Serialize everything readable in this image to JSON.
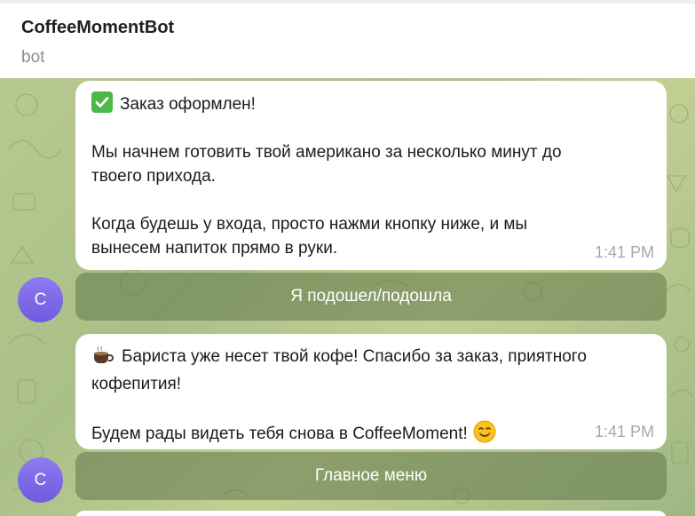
{
  "header": {
    "title": "CoffeeMomentBot",
    "subtitle": "bot"
  },
  "messages": [
    {
      "lines": [
        {
          "text": "Заказ оформлен!",
          "icon": "check-mark-emoji"
        },
        {
          "text": ""
        },
        {
          "text": "Мы начнем готовить твой американо за несколько минут до"
        },
        {
          "text": "твоего прихода."
        },
        {
          "text": ""
        },
        {
          "text": "Когда будешь у входа, просто нажми кнопку ниже, и мы"
        },
        {
          "text": "вынесем напиток прямо в руки."
        }
      ],
      "time": "1:41 PM",
      "button": "Я подошел/подошла"
    },
    {
      "lines": [
        {
          "text": "Бариста уже несет твой кофе! Спасибо за заказ, приятного",
          "icon": "hot-beverage-emoji"
        },
        {
          "text": "кофепития!"
        },
        {
          "text": ""
        },
        {
          "text": "Будем рады видеть тебя снова в CoffeeMoment!",
          "icon_after": "smiling-face-emoji"
        }
      ],
      "time": "1:41 PM",
      "button": "Главное меню"
    }
  ],
  "avatar_letter": "C",
  "colors": {
    "accent_avatar": "#7b68ee",
    "button_bg": "#6b8152",
    "chat_bg": "#b5c78d"
  }
}
